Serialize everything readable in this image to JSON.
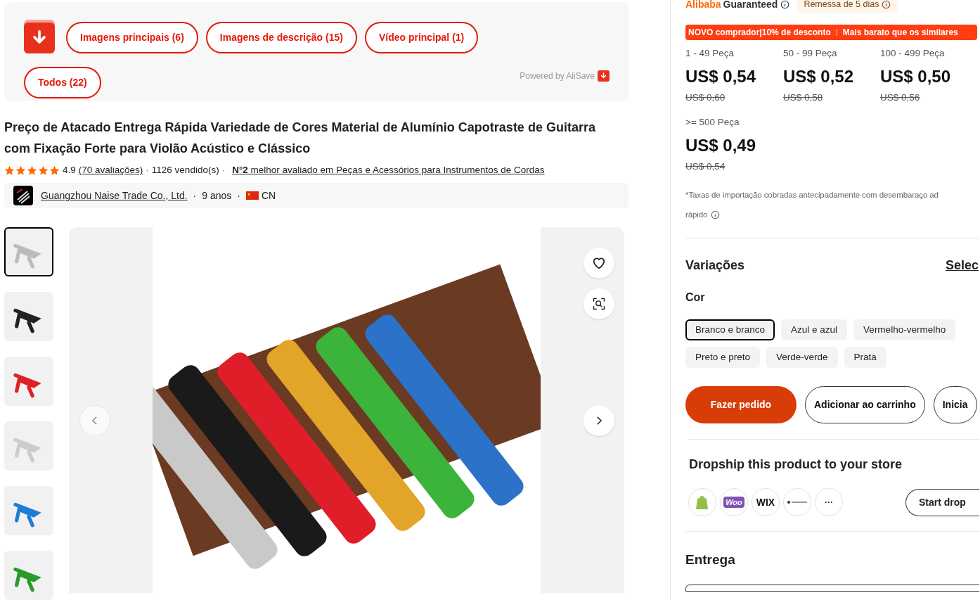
{
  "alisave": {
    "buttons": [
      "Imagens principais (6)",
      "Imagens de descrição (15)",
      "Vídeo principal (1)",
      "Todos (22)"
    ],
    "powered_by": "Powered by AliSave"
  },
  "product": {
    "title": "Preço de Atacado Entrega Rápida Variedade de Cores Material de Alumínio Capotraste de Guitarra com Fixação Forte para Violão Acústico e Clássico",
    "stars": 5,
    "rating": "4.9",
    "reviews": "(70 avaliações)",
    "sold": "1126 vendido(s)",
    "separators": [
      "·",
      "·"
    ],
    "rank": "**N°2** melhor avaliado em Peças e Acessórios para Instrumentos de Cordas"
  },
  "seller": {
    "name": "Guangzhou Naise Trade Co., Ltd.",
    "years": "9 anos",
    "country": "CN",
    "separators": [
      "·",
      "·"
    ]
  },
  "gallery": {
    "thumbnails": [
      {
        "selected": true
      },
      {
        "selected": false
      },
      {
        "selected": false
      },
      {
        "selected": false
      },
      {
        "selected": false
      },
      {
        "selected": false
      }
    ]
  },
  "badges": {
    "brand": "Alibaba",
    "guaranteed": "Guaranteed",
    "shipping": "Remessa de 5 dias"
  },
  "promo": [
    "NOVO comprador|10% de desconto",
    "Mais barato que os similares"
  ],
  "tiers": [
    {
      "range": "1 - 49 Peça",
      "price": "US$ 0,54",
      "old_price": "US$ 0,60"
    },
    {
      "range": "50 - 99 Peça",
      "price": "US$ 0,52",
      "old_price": "US$ 0,58"
    },
    {
      "range": "100 - 499 Peça",
      "price": "US$ 0,50",
      "old_price": "US$ 0,56"
    },
    {
      "range": ">= 500 Peça",
      "price": "US$ 0,49",
      "old_price": "US$ 0,54"
    }
  ],
  "tax_note": [
    "*Taxas de importação cobradas antecipadamente com desembaraço ad",
    "rápido"
  ],
  "variations": {
    "title": "Variações",
    "select_link": "Selec",
    "group": "Cor",
    "options": [
      {
        "label": "Branco e branco",
        "selected": true
      },
      {
        "label": "Azul e azul",
        "selected": false
      },
      {
        "label": "Vermelho-vermelho",
        "selected": false
      },
      {
        "label": "Preto e preto",
        "selected": false
      },
      {
        "label": "Verde-verde",
        "selected": false
      },
      {
        "label": "Prata",
        "selected": false
      }
    ]
  },
  "actions": [
    {
      "kind": "primary",
      "label": "Fazer pedido"
    },
    {
      "kind": "outline",
      "label": "Adicionar ao carrinho"
    },
    {
      "kind": "outline",
      "label": "Inicia"
    }
  ],
  "dropship": {
    "title": "Dropship this product to your store",
    "platforms": [
      {
        "kind": "shopify"
      },
      {
        "kind": "woo",
        "label": "Woo"
      },
      {
        "kind": "wix",
        "label": "WIX"
      },
      {
        "kind": "squarespace"
      },
      {
        "kind": "more",
        "label": "···"
      }
    ],
    "start": "Start drop"
  },
  "delivery": {
    "title": "Entrega"
  }
}
